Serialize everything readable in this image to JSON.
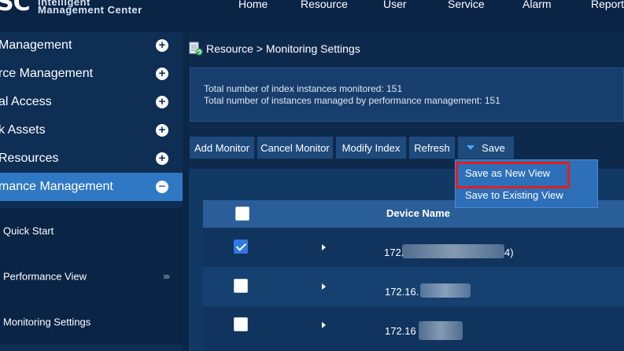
{
  "header": {
    "logo_mark": "SC",
    "logo_line1": "Intelligent",
    "logo_line2": "Management Center",
    "nav": [
      "Home",
      "Resource",
      "User",
      "Service",
      "Alarm",
      "Report"
    ]
  },
  "sidebar": {
    "items": [
      {
        "label": "Management",
        "icon": "plus-circle-icon"
      },
      {
        "label": "rce Management",
        "icon": "plus-circle-icon"
      },
      {
        "label": "al Access",
        "icon": "plus-circle-icon"
      },
      {
        "label": "k Assets",
        "icon": "plus-circle-icon"
      },
      {
        "label": "Resources",
        "icon": "plus-circle-icon"
      },
      {
        "label": "mance Management",
        "icon": "minus-circle-icon"
      }
    ],
    "subitems": [
      {
        "label": "Quick Start"
      },
      {
        "label": "Performance View",
        "expand": "›››"
      },
      {
        "label": "Monitoring Settings"
      }
    ]
  },
  "breadcrumb": "Resource > Monitoring Settings",
  "info": {
    "line1": "Total number of index instances monitored: 151",
    "line2": "Total number of instances managed by performance management: 151"
  },
  "toolbar": {
    "add_monitor": "Add Monitor",
    "cancel_monitor": "Cancel Monitor",
    "modify_index": "Modify Index",
    "refresh": "Refresh",
    "save": "Save"
  },
  "save_menu": {
    "save_as_new_view": "Save as New View",
    "save_to_existing_view": "Save to Existing View"
  },
  "table": {
    "columns": [
      "Device Name"
    ],
    "rows": [
      {
        "checked": true,
        "device_prefix": "172.",
        "device_suffix": "4)"
      },
      {
        "checked": false,
        "device_prefix": "172.16.",
        "device_suffix": ""
      },
      {
        "checked": false,
        "device_prefix": "172.16",
        "device_suffix": ""
      }
    ]
  },
  "colors": {
    "active_nav": "#2f78c4",
    "highlight_border": "#e02020",
    "dropdown_bg": "#2d6fb8"
  }
}
